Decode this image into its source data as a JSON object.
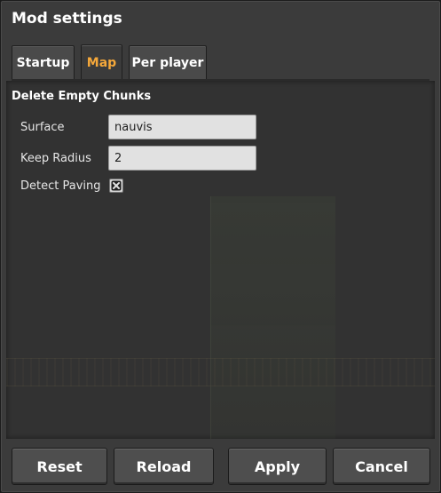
{
  "window": {
    "title": "Mod settings"
  },
  "tabs": [
    {
      "label": "Startup",
      "active": false
    },
    {
      "label": "Map",
      "active": true
    },
    {
      "label": "Per player",
      "active": false
    }
  ],
  "section": {
    "heading": "Delete Empty Chunks",
    "settings": [
      {
        "label": "Surface",
        "type": "text",
        "value": "nauvis"
      },
      {
        "label": "Keep Radius",
        "type": "text",
        "value": "2"
      },
      {
        "label": "Detect Paving",
        "type": "checkbox",
        "checked": true
      }
    ]
  },
  "buttons": {
    "reset": "Reset",
    "reload": "Reload",
    "apply": "Apply",
    "cancel": "Cancel"
  },
  "colors": {
    "active_tab_text": "#f5a83a",
    "panel": "#3b3b3b",
    "field": "#e1e1e1"
  }
}
